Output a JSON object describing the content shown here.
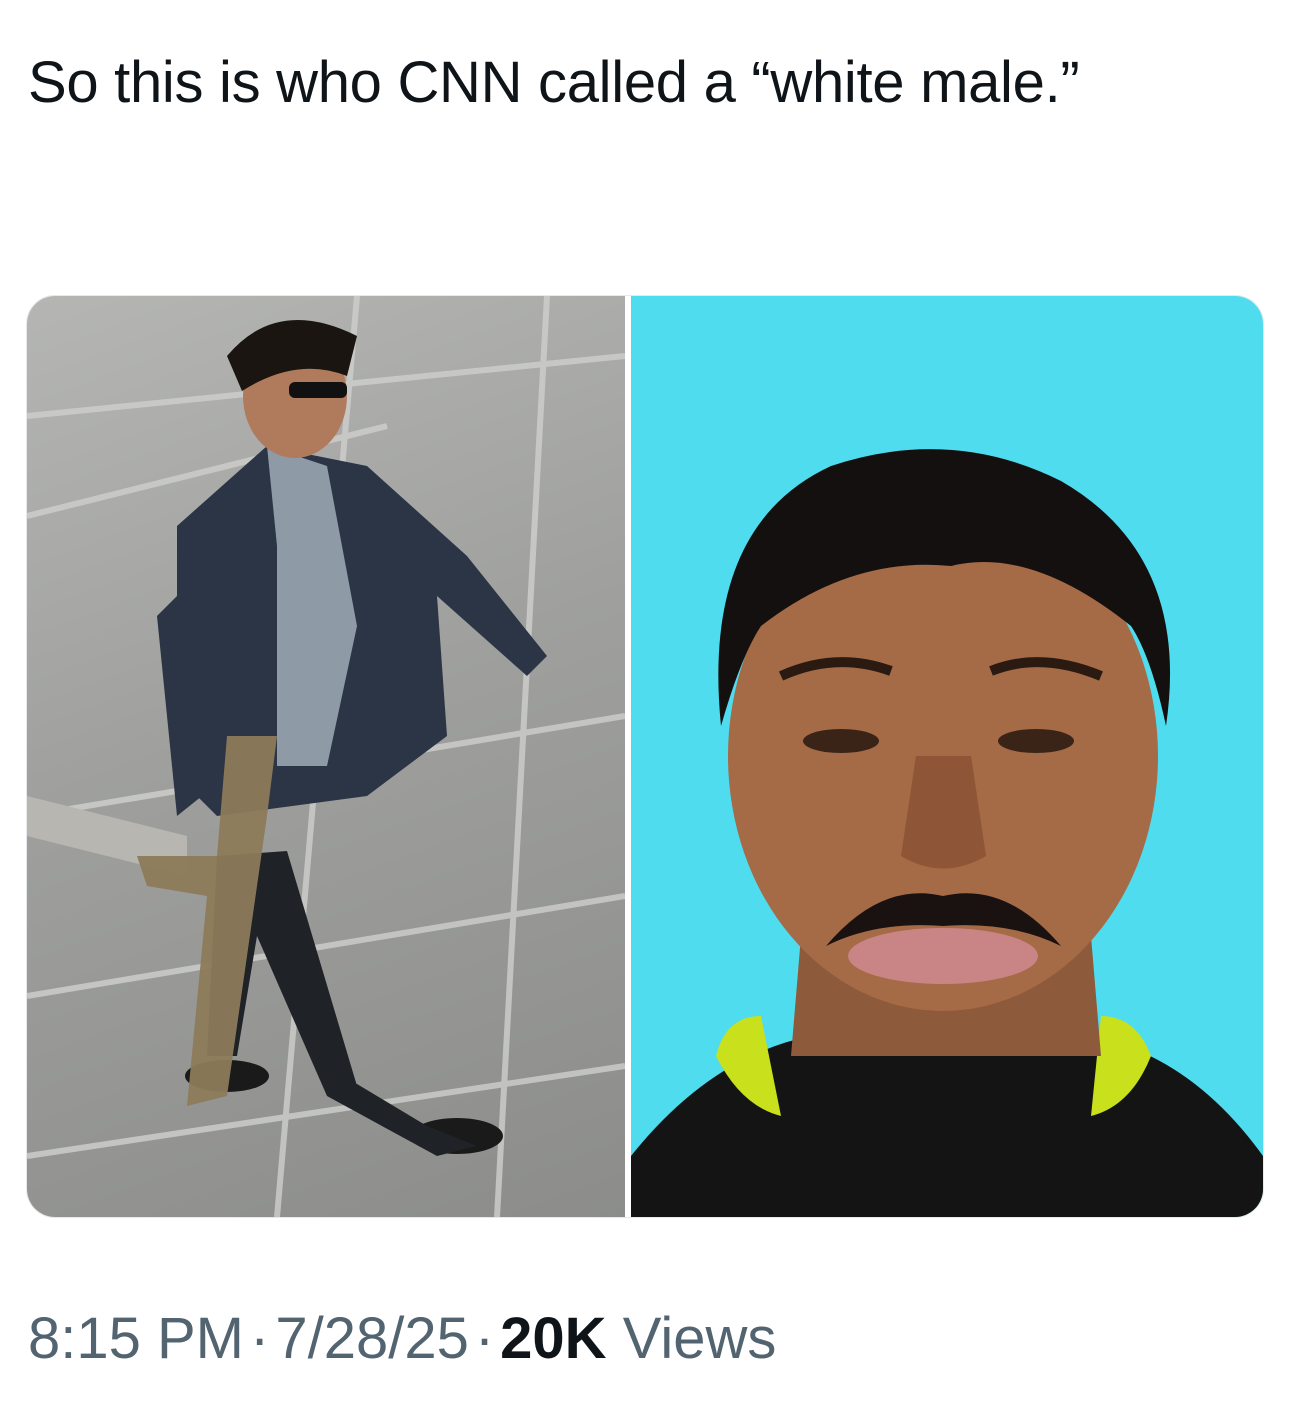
{
  "tweet": {
    "text": "So this is who CNN called a “white male.”",
    "media": {
      "left_photo": {
        "alt": ""
      },
      "right_photo": {
        "alt": ""
      }
    },
    "time": "8:15 PM",
    "date": "7/28/25",
    "views_count": "20K",
    "views_label": "Views",
    "separator": "·"
  },
  "colors": {
    "text_primary": "#0f1419",
    "text_secondary": "#536471",
    "photo_background_cyan": "#4fdcee",
    "pavement_gray": "#a3a4a2"
  }
}
